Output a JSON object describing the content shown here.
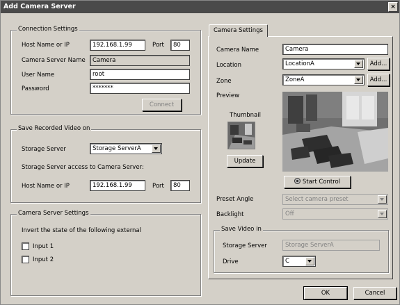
{
  "window": {
    "title": "Add Camera Server",
    "close": "×"
  },
  "connection": {
    "legend": "Connection Settings",
    "host_label": "Host Name or IP",
    "host_value": "192.168.1.99",
    "port_label": "Port",
    "port_value": "80",
    "server_name_label": "Camera Server Name",
    "server_name_value": "Camera",
    "user_label": "User Name",
    "user_value": "root",
    "password_label": "Password",
    "password_value": "*******",
    "connect_label": "Connect"
  },
  "recorded": {
    "legend": "Save Recorded Video on",
    "storage_label": "Storage Server",
    "storage_value": "Storage ServerA",
    "access_text": "Storage Server access to Camera Server:",
    "host_label": "Host Name or IP",
    "host_value": "192.168.1.99",
    "port_label": "Port",
    "port_value": "80"
  },
  "server_settings": {
    "legend": "Camera Server Settings",
    "invert_text": "Invert the state of the following external",
    "input1": "Input 1",
    "input2": "Input 2"
  },
  "camera": {
    "tab": "Camera Settings",
    "name_label": "Camera Name",
    "name_value": "Camera",
    "location_label": "Location",
    "location_value": "LocationA",
    "add_label": "Add...",
    "zone_label": "Zone",
    "zone_value": "ZoneA",
    "preview_label": "Preview",
    "thumbnail_label": "Thumbnail",
    "update_label": "Update",
    "start_control_label": "Start Control",
    "preset_label": "Preset Angle",
    "preset_placeholder": "Select camera preset",
    "backlight_label": "Backlight",
    "backlight_value": "Off"
  },
  "save_video": {
    "legend": "Save Video in",
    "storage_label": "Storage Server",
    "storage_value": "Storage ServerA",
    "drive_label": "Drive",
    "drive_value": "C"
  },
  "footer": {
    "ok": "OK",
    "cancel": "Cancel"
  }
}
